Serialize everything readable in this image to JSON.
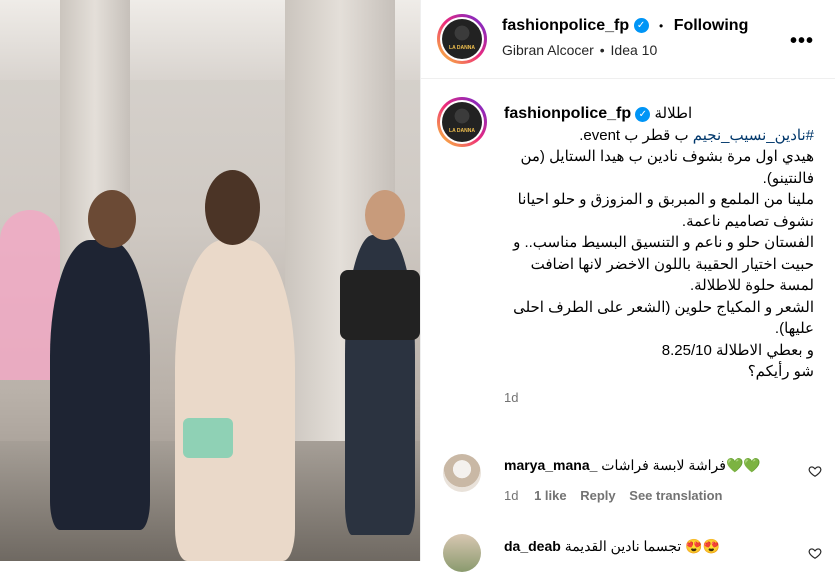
{
  "header": {
    "username": "fashionpolice_fp",
    "follow_status": "Following",
    "separator": "•",
    "audio": "Gibran Alcocer",
    "audio_separator": "•",
    "track": "Idea 10",
    "more": "•••",
    "avatar_text": "LA DANNA"
  },
  "post": {
    "username": "fashionpolice_fp",
    "caption_lead": "اطلالة",
    "hashtag": "#نادين_نسيب_نجيم",
    "caption_line1_rest": " ب قطر ب event.",
    "lines": [
      "هيدي اول مرة بشوف نادين ب هيدا الستايل (من فالنتينو).",
      "ملينا من الملمع و المبربق و المزوزق و حلو احيانا نشوف تصاميم ناعمة.",
      "الفستان حلو و ناعم و التنسيق البسيط مناسب.. و حبيت اختيار الحقيبة باللون الاخضر لانها اضافت لمسة حلوة للاطلالة.",
      "الشعر و المكياج حلوين (الشعر على الطرف احلى عليها).",
      "و بعطي الاطلالة 8.25/10",
      "شو رأيكم؟"
    ],
    "time": "1d"
  },
  "comments": [
    {
      "username": "marya_mana_",
      "text": "فراشة لابسة فراشات💚💚",
      "time": "1d",
      "likes": "1 like",
      "reply": "Reply",
      "translate": "See translation"
    },
    {
      "username": "da_deab",
      "text": "تجسما نادين القديمة 😍😍",
      "time": "",
      "likes": "",
      "reply": "",
      "translate": ""
    }
  ],
  "colors": {
    "verified": "#0095f6",
    "hashtag": "#00376b",
    "muted": "#737373"
  }
}
